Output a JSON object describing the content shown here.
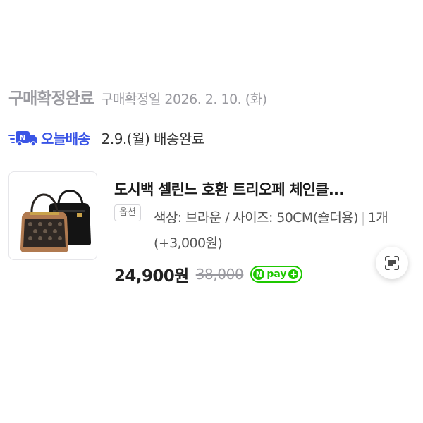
{
  "order": {
    "status_title": "구매확정완료",
    "status_date": "구매확정일 2026. 2. 10. (화)"
  },
  "delivery": {
    "label": "오늘배송",
    "status": "2.9.(월) 배송완료",
    "icon": "truck-icon",
    "accent_color": "#3a55e6"
  },
  "product": {
    "name": "도시백 셀린느 호환 트리오페 체인클...",
    "option_badge": "옵션",
    "option_text": "색상: 브라운 / 사이즈: 50CM(숄더용)",
    "quantity": "1개 (+3,000원)",
    "price_current": "24,900원",
    "price_original": "38,000",
    "npay_label": "pay",
    "npay_letter": "N",
    "npay_plus": "+",
    "npay_color": "#1ec800"
  },
  "actions": {
    "scan_icon": "text-scan-icon"
  }
}
